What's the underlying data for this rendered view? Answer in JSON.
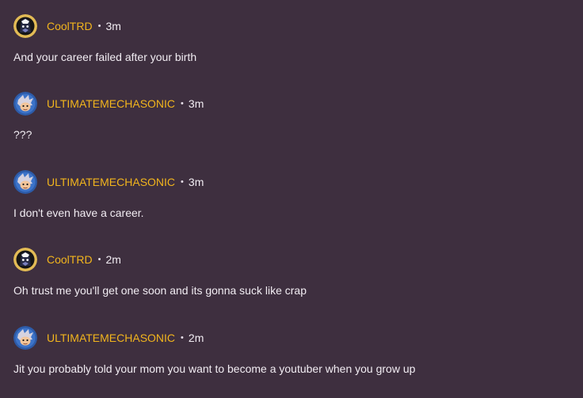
{
  "comments": [
    {
      "author": "CoolTRD",
      "avatar_icon": "dark-helmet-avatar-icon",
      "separator": "•",
      "time": "3m",
      "text": "And your career failed after your birth"
    },
    {
      "author": "ULTIMATEMECHASONIC",
      "avatar_icon": "blue-hedgehog-avatar-icon",
      "separator": "•",
      "time": "3m",
      "text": "???"
    },
    {
      "author": "ULTIMATEMECHASONIC",
      "avatar_icon": "blue-hedgehog-avatar-icon",
      "separator": "•",
      "time": "3m",
      "text": "I don't even have a career."
    },
    {
      "author": "CoolTRD",
      "avatar_icon": "dark-helmet-avatar-icon",
      "separator": "•",
      "time": "2m",
      "text": "Oh trust me you'll get one soon and its gonna suck like crap"
    },
    {
      "author": "ULTIMATEMECHASONIC",
      "avatar_icon": "blue-hedgehog-avatar-icon",
      "separator": "•",
      "time": "2m",
      "text": "Jit you probably told your mom you want to become a youtuber when you grow up"
    }
  ],
  "colors": {
    "background": "#3e2f3f",
    "username": "#f2b51d",
    "text": "#f1ecf2"
  }
}
